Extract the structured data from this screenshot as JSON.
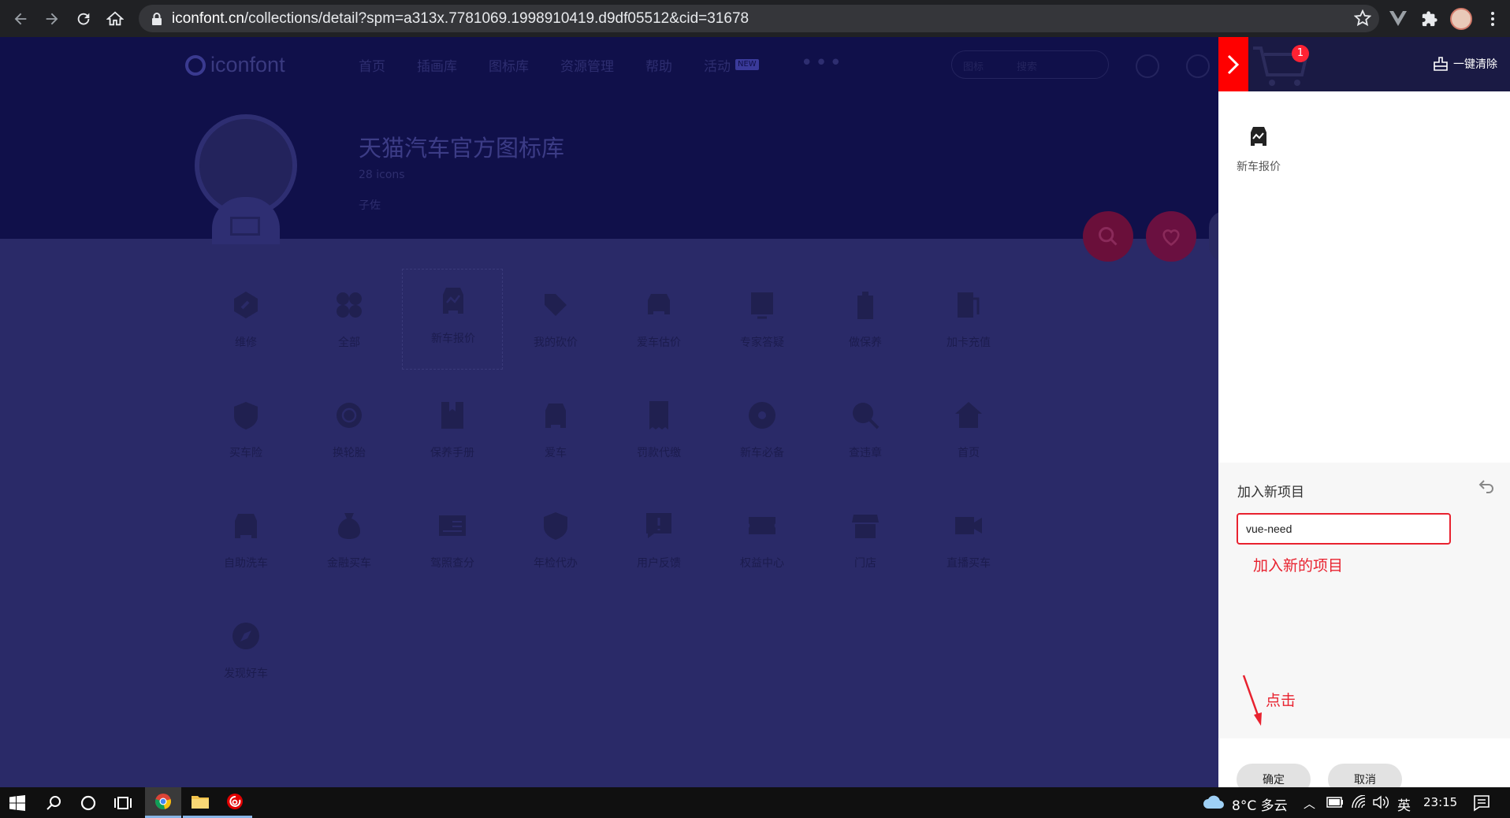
{
  "browser": {
    "url_domain": "iconfont.cn",
    "url_path": "/collections/detail?spm=a313x.7781069.1998910419.d9df05512&cid=31678"
  },
  "site": {
    "logo": "iconfont",
    "nav": [
      "首页",
      "插画库",
      "图标库",
      "资源管理",
      "帮助",
      "活动"
    ],
    "nav_badge": "NEW",
    "search_option": "图标",
    "search_placeholder": "搜索"
  },
  "library": {
    "title": "天猫汽车官方图标库",
    "count": "28 icons",
    "author": "子佐"
  },
  "icons": [
    {
      "label": "维修",
      "icon": "wrench-hex-icon"
    },
    {
      "label": "全部",
      "icon": "four-petal-icon"
    },
    {
      "label": "新车报价",
      "icon": "car-quote-icon",
      "selected": true
    },
    {
      "label": "我的砍价",
      "icon": "tag-pen-icon"
    },
    {
      "label": "爱车估价",
      "icon": "car-value-icon"
    },
    {
      "label": "专家答疑",
      "icon": "question-board-icon"
    },
    {
      "label": "做保养",
      "icon": "oil-can-icon"
    },
    {
      "label": "加卡充值",
      "icon": "fuel-pump-icon"
    },
    {
      "label": "买车险",
      "icon": "shield-insurance-icon"
    },
    {
      "label": "换轮胎",
      "icon": "tire-icon"
    },
    {
      "label": "保养手册",
      "icon": "manual-book-icon"
    },
    {
      "label": "爱车",
      "icon": "car-front-icon"
    },
    {
      "label": "罚款代缴",
      "icon": "yuan-receipt-icon"
    },
    {
      "label": "新车必备",
      "icon": "steering-wheel-icon"
    },
    {
      "label": "查违章",
      "icon": "search-violation-icon"
    },
    {
      "label": "首页",
      "icon": "home-icon"
    },
    {
      "label": "自助洗车",
      "icon": "car-wash-icon"
    },
    {
      "label": "金融买车",
      "icon": "money-bag-icon"
    },
    {
      "label": "驾照查分",
      "icon": "license-card-icon"
    },
    {
      "label": "年检代办",
      "icon": "inspection-shield-icon"
    },
    {
      "label": "用户反馈",
      "icon": "feedback-alert-icon"
    },
    {
      "label": "权益中心",
      "icon": "coupon-yuan-icon"
    },
    {
      "label": "门店",
      "icon": "store-icon"
    },
    {
      "label": "直播买车",
      "icon": "live-video-icon"
    },
    {
      "label": "发现好车",
      "icon": "compass-icon"
    }
  ],
  "cart": {
    "badge_count": "1",
    "clear_all": "一键清除",
    "items": [
      {
        "label": "新车报价",
        "icon": "car-quote-icon"
      }
    ]
  },
  "add_project": {
    "title": "加入新项目",
    "input_value": "vue-need",
    "annotation": "加入新的项目",
    "click_annotation": "点击",
    "confirm": "确定",
    "cancel": "取消"
  },
  "taskbar": {
    "weather": "8°C 多云",
    "ime": "英",
    "time": "23:15"
  },
  "colors": {
    "accent_red": "#ff0000",
    "annotation_red": "#e8222f",
    "page_overlay": "#2a2a68"
  }
}
